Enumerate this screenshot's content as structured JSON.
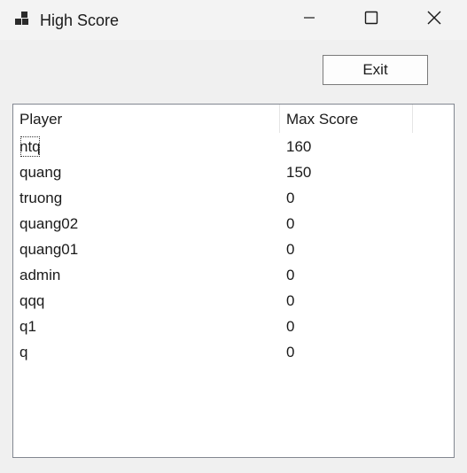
{
  "window": {
    "title": "High Score",
    "icon": "app-grid-icon"
  },
  "controls": {
    "minimize_icon": "minimize-icon",
    "maximize_icon": "maximize-icon",
    "close_icon": "close-icon"
  },
  "exit_button": {
    "label": "Exit"
  },
  "table": {
    "columns": [
      "Player",
      "Max Score"
    ],
    "rows": [
      {
        "player": "ntq",
        "score": "160"
      },
      {
        "player": "quang",
        "score": "150"
      },
      {
        "player": "truong",
        "score": "0"
      },
      {
        "player": "quang02",
        "score": "0"
      },
      {
        "player": "quang01",
        "score": "0"
      },
      {
        "player": "admin",
        "score": "0"
      },
      {
        "player": "qqq",
        "score": "0"
      },
      {
        "player": "q1",
        "score": "0"
      },
      {
        "player": "q",
        "score": "0"
      }
    ]
  }
}
